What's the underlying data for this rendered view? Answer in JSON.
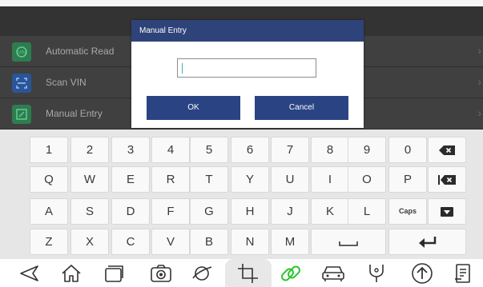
{
  "dialog": {
    "title": "Manual Entry",
    "input_value": "",
    "ok_label": "OK",
    "cancel_label": "Cancel"
  },
  "menu": {
    "items": [
      {
        "label": "Automatic Read",
        "icon": "auto-read-icon",
        "color": "#2f8c55"
      },
      {
        "label": "Scan VIN",
        "icon": "scan-vin-icon",
        "color": "#2f5ea6"
      },
      {
        "label": "Manual Entry",
        "icon": "manual-entry-icon",
        "color": "#2f8c55"
      }
    ]
  },
  "keyboard": {
    "row1": [
      "1",
      "2",
      "3",
      "4",
      "5",
      "6",
      "7",
      "8",
      "9",
      "0"
    ],
    "row2": [
      "Q",
      "W",
      "E",
      "R",
      "T",
      "Y",
      "U",
      "I",
      "O",
      "P"
    ],
    "row3": [
      "A",
      "S",
      "D",
      "F",
      "G",
      "H",
      "J",
      "K",
      "L"
    ],
    "caps_label": "Caps",
    "row4": [
      "Z",
      "X",
      "C",
      "V",
      "B",
      "N",
      "M"
    ]
  },
  "navbar": {
    "icons": [
      "back-icon",
      "home-icon",
      "recent-apps-icon",
      "camera-icon",
      "browser-icon",
      "crop-icon",
      "link-icon",
      "car-icon",
      "stethoscope-icon",
      "upload-icon",
      "document-icon"
    ]
  },
  "colors": {
    "dialog_header": "#2d4379",
    "button": "#2a4383",
    "link_icon": "#29c52d",
    "caret": "#38b7b2"
  }
}
